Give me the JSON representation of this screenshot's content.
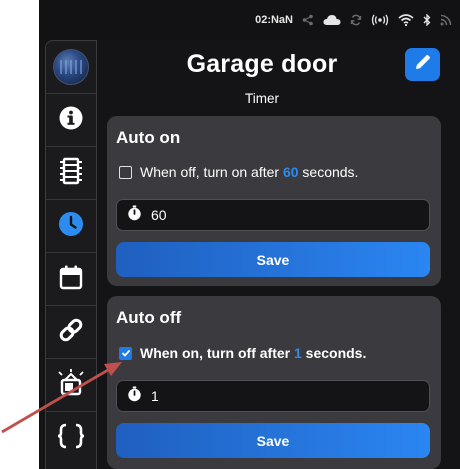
{
  "status_bar": {
    "time": "02:NaN",
    "icons": [
      "share-icon",
      "cloud-icon",
      "sync-icon",
      "broadcast-icon",
      "wifi-icon",
      "bluetooth-icon",
      "rss-icon"
    ]
  },
  "sidebar": {
    "items": [
      {
        "name": "avatar",
        "icon": "device-avatar"
      },
      {
        "name": "info",
        "icon": "info-icon"
      },
      {
        "name": "door",
        "icon": "door-icon"
      },
      {
        "name": "timer",
        "icon": "clock-icon",
        "active": true
      },
      {
        "name": "schedule",
        "icon": "calendar-icon"
      },
      {
        "name": "links",
        "icon": "link-icon"
      },
      {
        "name": "scenes",
        "icon": "tv-icon"
      },
      {
        "name": "code",
        "icon": "code-icon"
      }
    ]
  },
  "header": {
    "title": "Garage door",
    "subtitle": "Timer"
  },
  "auto_on": {
    "heading": "Auto on",
    "checkbox_checked": false,
    "label_before": "When off, turn on after ",
    "seconds_value": "60",
    "label_after": " seconds.",
    "input_value": "60",
    "save_label": "Save"
  },
  "auto_off": {
    "heading": "Auto off",
    "checkbox_checked": true,
    "label_before": "When on, turn off after ",
    "seconds_value": "1",
    "label_after": " seconds.",
    "input_value": "1",
    "save_label": "Save"
  },
  "colors": {
    "accent": "#1e7be8",
    "card": "#3b3b3f",
    "background": "#141416",
    "annotation_arrow": "#c0504d"
  }
}
